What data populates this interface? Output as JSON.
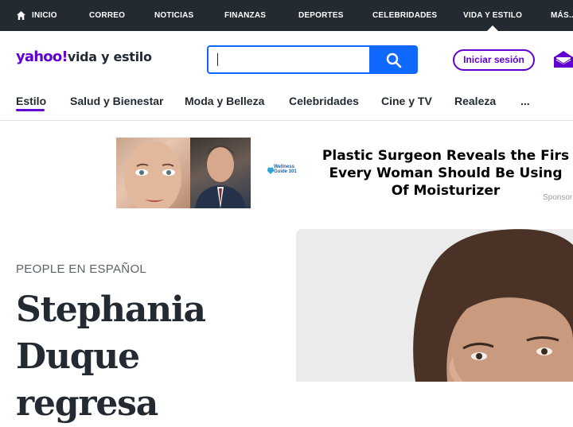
{
  "topnav": {
    "items": [
      "INICIO",
      "CORREO",
      "NOTICIAS",
      "FINANZAS",
      "DEPORTES",
      "CELEBRIDADES",
      "VIDA Y ESTILO",
      "MÁS..."
    ]
  },
  "header": {
    "logo_brand": "yahoo!",
    "logo_section": "vida y estilo",
    "search_value": "",
    "signin_label": "Iniciar sesión",
    "icons": {
      "search": "search-icon",
      "mail": "mail-icon",
      "home": "home-icon"
    }
  },
  "subnav": {
    "tabs": [
      "Estilo",
      "Salud y Bienestar",
      "Moda y Belleza",
      "Celebridades",
      "Cine y TV",
      "Realeza",
      "..."
    ],
    "active_index": 0
  },
  "ad": {
    "headline": [
      "Plastic Surgeon Reveals the Firs",
      "Every Woman Should Be Using",
      "Of Moisturizer"
    ],
    "brand_line1": "Wellness",
    "brand_line2": "Guide 101",
    "sponsored": "Sponsor"
  },
  "article": {
    "kicker": "PEOPLE EN ESPAÑOL",
    "title_line1": "Stephania",
    "title_line2": "Duque regresa"
  },
  "colors": {
    "topnav_bg": "#232a31",
    "brand_purple": "#6001d2",
    "search_blue": "#0f69ff",
    "text_dark": "#232a31"
  }
}
